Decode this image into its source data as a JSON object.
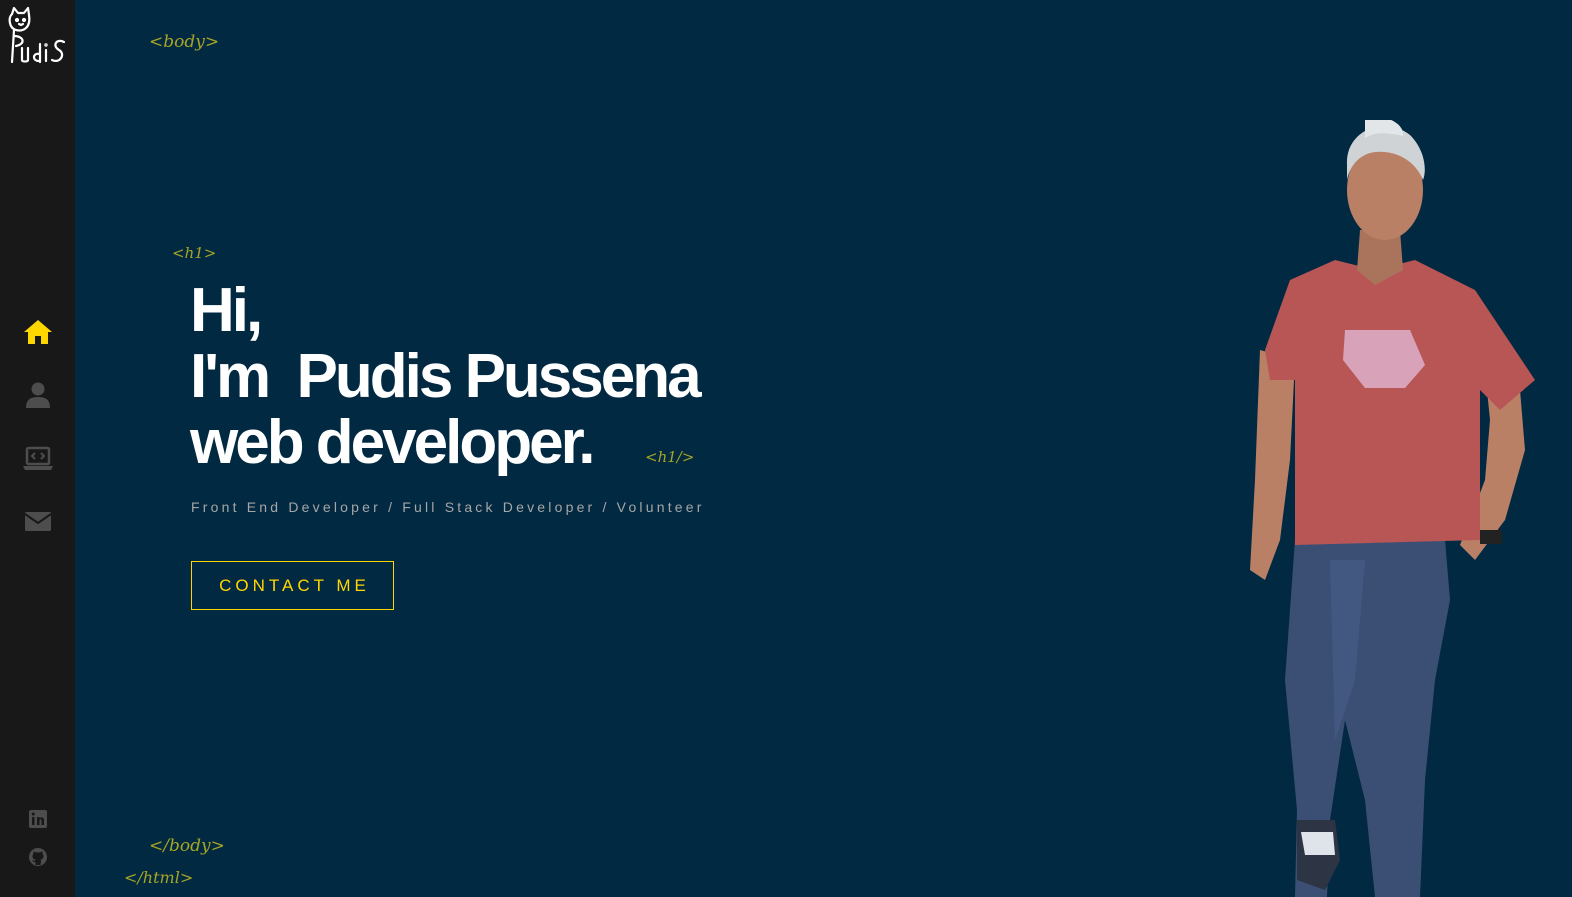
{
  "logo": {
    "text": "Pudis"
  },
  "nav": {
    "items": [
      {
        "id": "home",
        "icon": "home-icon",
        "active": true
      },
      {
        "id": "about",
        "icon": "user-icon",
        "active": false
      },
      {
        "id": "projects",
        "icon": "laptop-code-icon",
        "active": false
      },
      {
        "id": "contact",
        "icon": "envelope-icon",
        "active": false
      }
    ]
  },
  "social": [
    {
      "icon": "linkedin-icon"
    },
    {
      "icon": "github-icon"
    }
  ],
  "tags": {
    "body_open": "<body>",
    "h1_open": "<h1>",
    "h1_close": "<h1/>",
    "body_close": "</body>",
    "html_close": "</html>"
  },
  "hero": {
    "line1": "Hi,",
    "line2": "I'm  Pudis Pussena",
    "line3": "web developer."
  },
  "subtitle": "Front End Developer / Full Stack Developer / Volunteer",
  "cta": {
    "label": "CONTACT ME"
  },
  "colors": {
    "background": "#022942",
    "sidebar": "#181818",
    "accent": "#ffd700",
    "tag": "#a6a624",
    "icon_inactive": "#4d4d4e"
  }
}
